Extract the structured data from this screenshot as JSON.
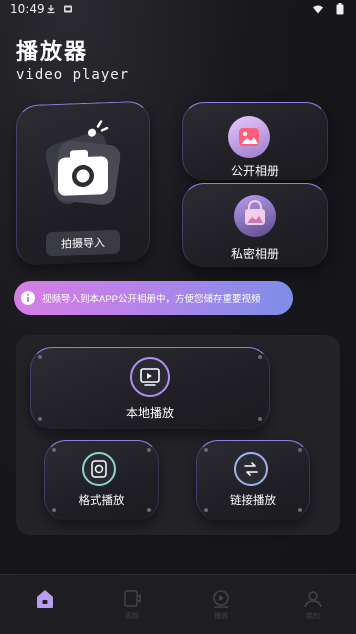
{
  "status_bar": {
    "time": "10:49",
    "icons": [
      "download-icon",
      "mail-icon",
      "wifi-icon",
      "battery-icon"
    ]
  },
  "header": {
    "title": "播放器",
    "subtitle": "video player"
  },
  "shoot_card": {
    "button_label": "拍摄导入",
    "icon": "camera-icon"
  },
  "public_album": {
    "label": "公开相册",
    "icon": "image-icon"
  },
  "private_album": {
    "label": "私密相册",
    "icon": "lock-image-icon"
  },
  "tip": {
    "text": "视频导入到本APP公开相册中，方便您储存重要视频",
    "icon": "info-icon"
  },
  "player": {
    "local": {
      "label": "本地播放",
      "icon": "monitor-icon"
    },
    "format": {
      "label": "格式播放",
      "icon": "format-icon"
    },
    "link": {
      "label": "链接播放",
      "icon": "link-icon"
    }
  },
  "bottom_nav": {
    "items": [
      {
        "label": "",
        "icon": "home-icon",
        "active": true
      },
      {
        "label": "视频",
        "icon": "video-icon",
        "active": false
      },
      {
        "label": "播放",
        "icon": "play-icon",
        "active": false
      },
      {
        "label": "我的",
        "icon": "user-icon",
        "active": false
      }
    ]
  },
  "colors": {
    "accent": "#b48ef0",
    "tip_gradient_start": "#d77ee6",
    "tip_gradient_end": "#7d8ee9",
    "background": "#18181c",
    "nav_active": "#b89cf2"
  }
}
